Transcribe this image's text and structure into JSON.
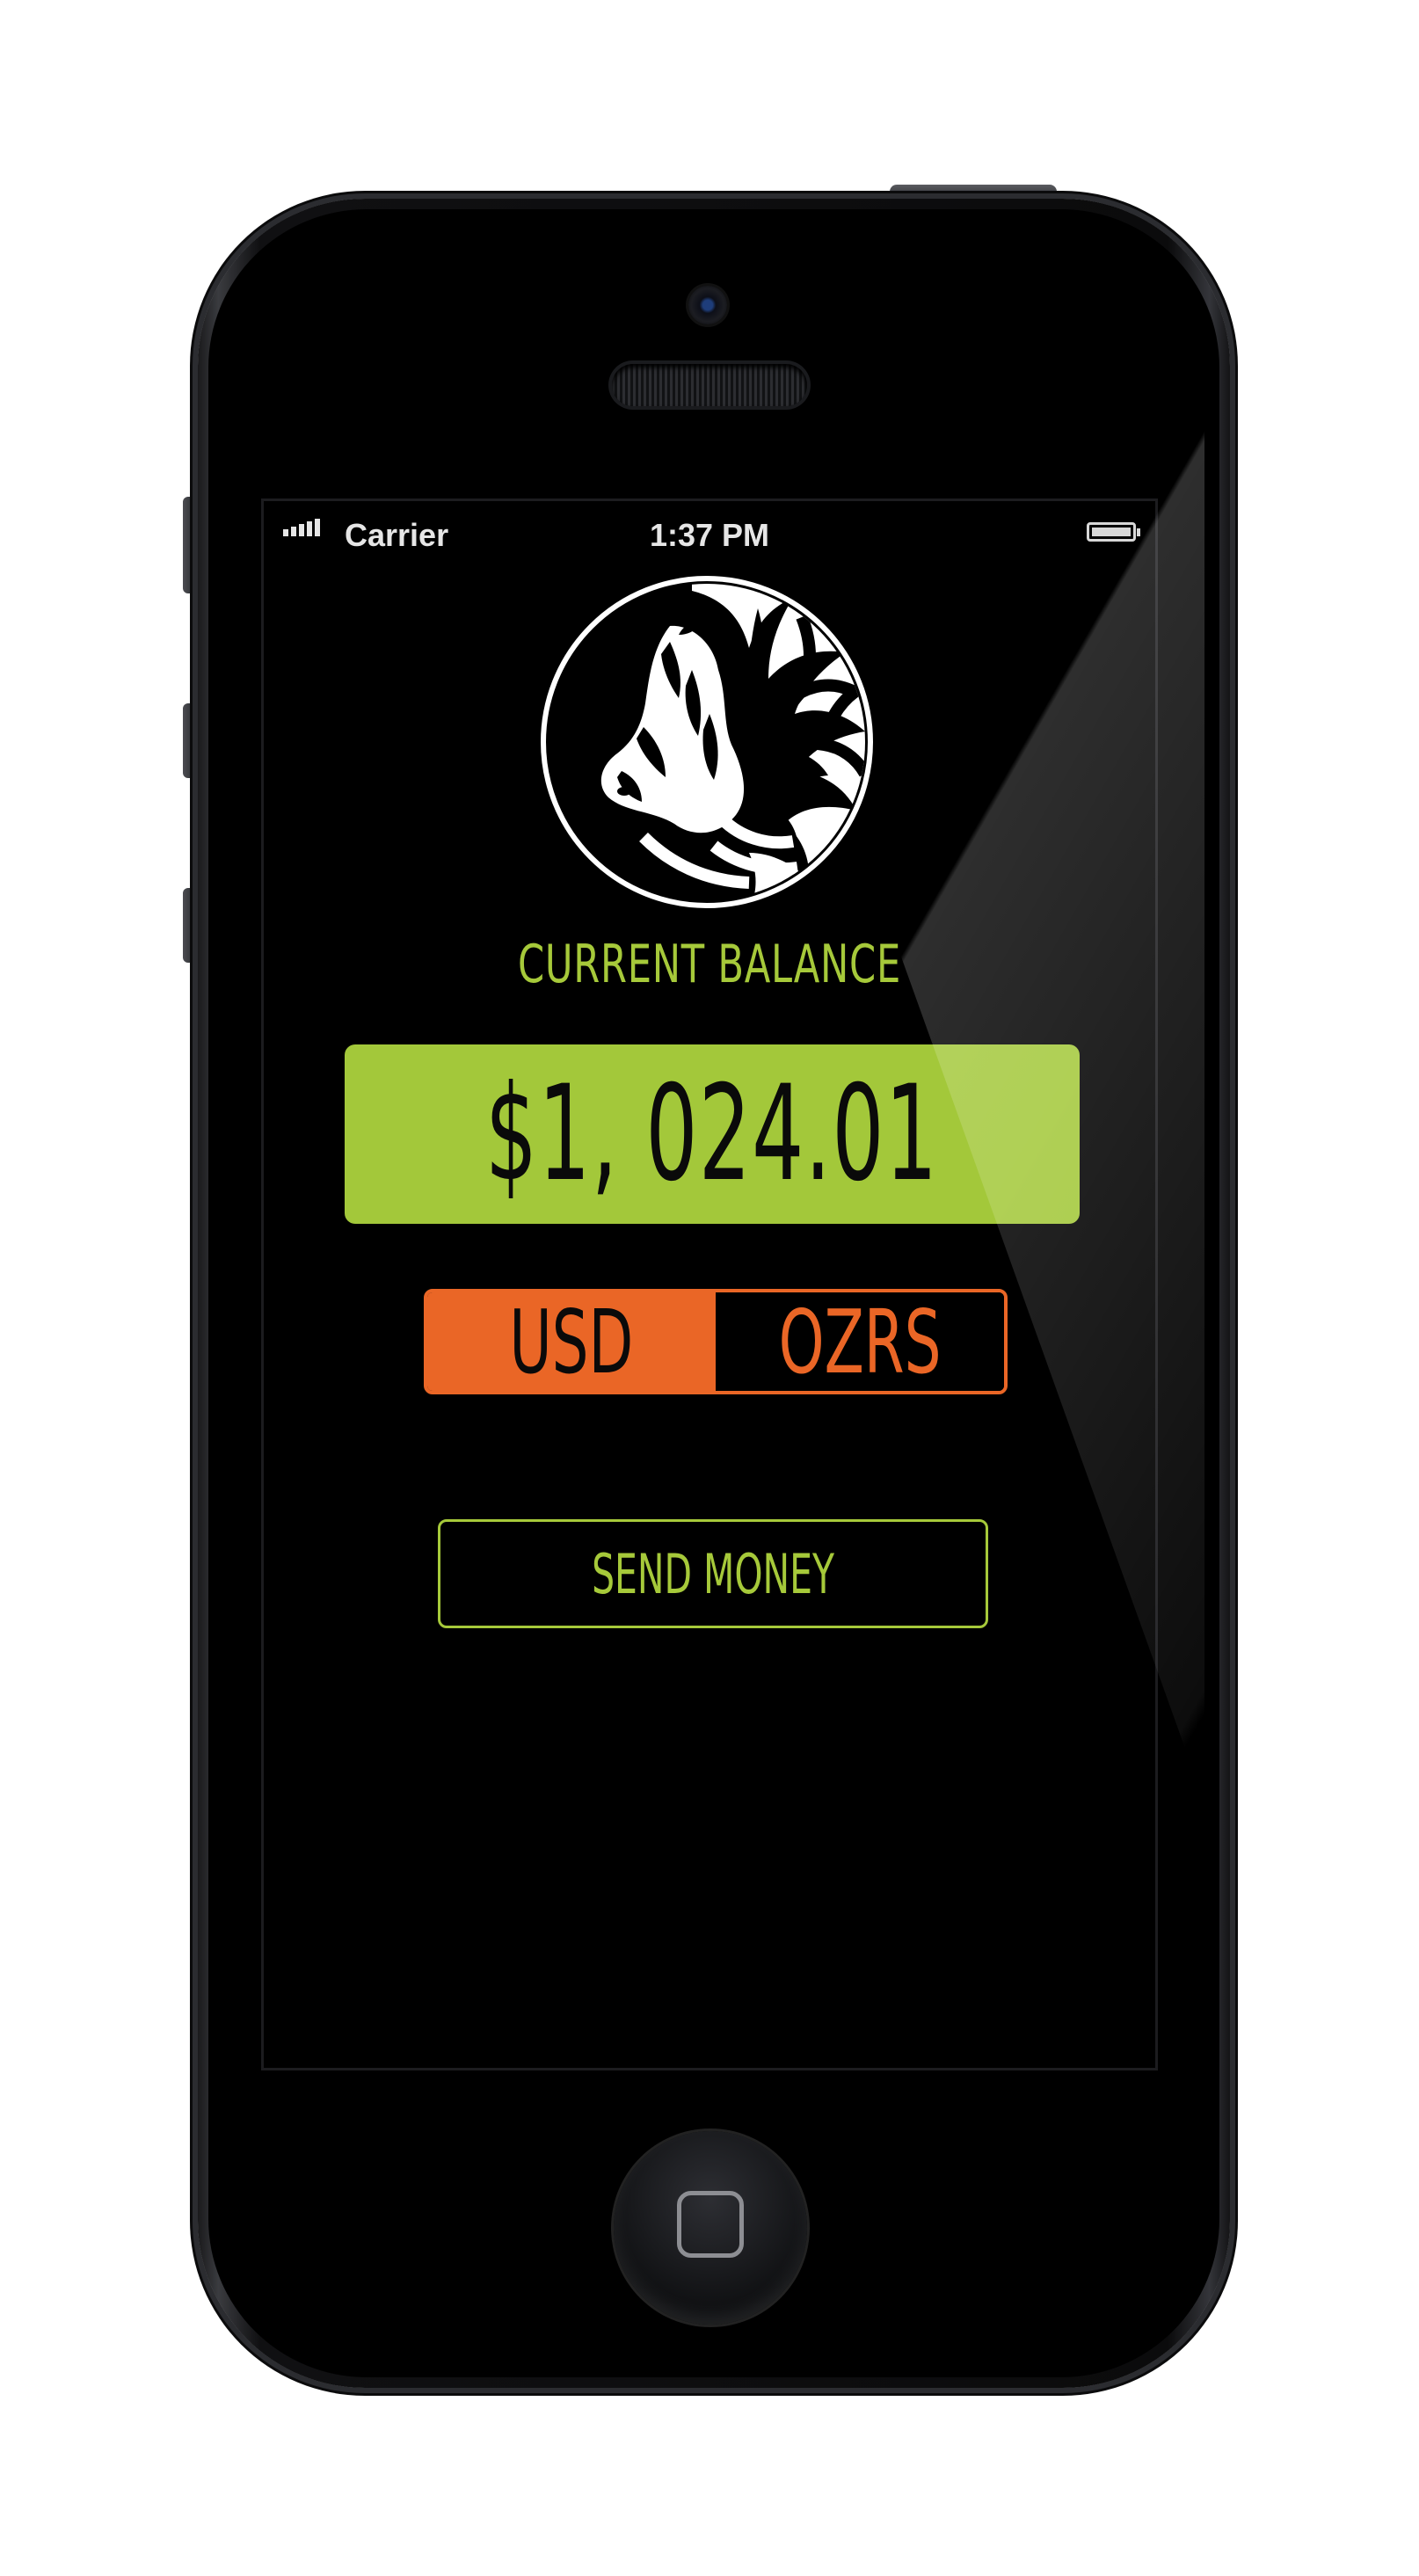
{
  "status_bar": {
    "carrier": "Carrier",
    "time": "1:37 PM"
  },
  "app": {
    "logo_icon": "zebra-head-icon",
    "balance_label": "CURRENT BALANCE",
    "balance_value": "$1, 024.01",
    "currency_toggle": {
      "options": [
        "USD",
        "OZRS"
      ],
      "selected": "USD"
    },
    "send_button_label": "SEND MONEY"
  },
  "colors": {
    "accent_green": "#a6c93a",
    "accent_orange": "#ea6626",
    "background": "#000000"
  }
}
